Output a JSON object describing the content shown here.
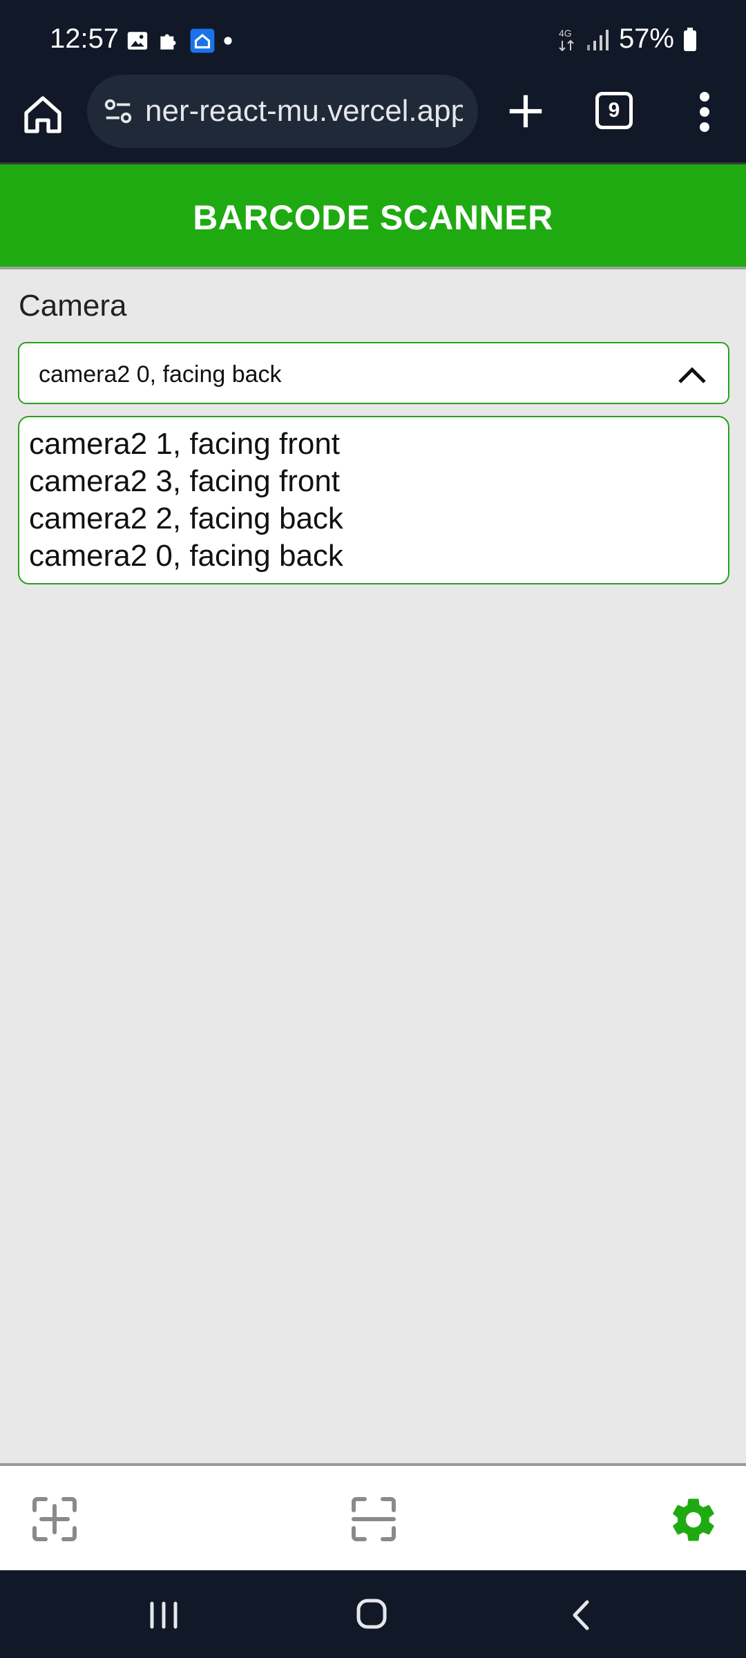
{
  "status_bar": {
    "time": "12:57",
    "left_icons": [
      "image-icon",
      "puzzle-icon",
      "home-app-icon",
      "dot-icon"
    ],
    "network": "4G",
    "battery": "57%"
  },
  "browser": {
    "url": "ner-react-mu.vercel.app",
    "tab_count": "9"
  },
  "app": {
    "title": "BARCODE SCANNER",
    "accent_color": "#1faa12"
  },
  "camera": {
    "label": "Camera",
    "selected": "camera2 0, facing back",
    "options": [
      "camera2 1, facing front",
      "camera2 3, facing front",
      "camera2 2, facing back",
      "camera2 0, facing back"
    ]
  },
  "bottom_nav": {
    "items": [
      {
        "icon": "scan-add-icon",
        "active": false
      },
      {
        "icon": "scan-icon",
        "active": false
      },
      {
        "icon": "settings-icon",
        "active": true
      }
    ]
  }
}
